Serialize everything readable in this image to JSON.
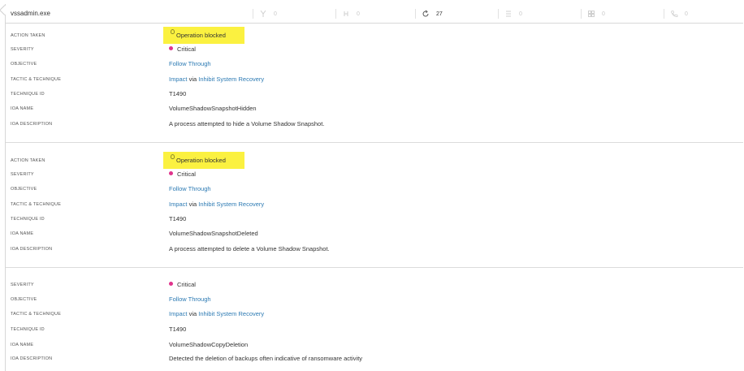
{
  "header": {
    "process_name": "vssadmin.exe",
    "stats": [
      {
        "icon": "branch-icon",
        "value": "0"
      },
      {
        "icon": "link-icon",
        "value": "0"
      },
      {
        "icon": "refresh-icon",
        "value": "27"
      },
      {
        "icon": "list-icon",
        "value": "0"
      },
      {
        "icon": "grid-icon",
        "value": "0"
      },
      {
        "icon": "phone-icon",
        "value": "0"
      }
    ]
  },
  "labels": {
    "action_taken": "ACTION TAKEN",
    "severity": "SEVERITY",
    "objective": "OBJECTIVE",
    "tactic_technique": "TACTIC & TECHNIQUE",
    "technique_id": "TECHNIQUE ID",
    "ioa_name": "IOA NAME",
    "ioa_description": "IOA DESCRIPTION",
    "via": "via"
  },
  "detections": [
    {
      "action": "Operation blocked",
      "severity": "Critical",
      "objective": "Follow Through",
      "tactic": "Impact",
      "technique": "Inhibit System Recovery",
      "technique_id": "T1490",
      "ioa_name": "VolumeShadowSnapshotHidden",
      "ioa_description": "A process attempted to hide a Volume Shadow Snapshot."
    },
    {
      "action": "Operation blocked",
      "severity": "Critical",
      "objective": "Follow Through",
      "tactic": "Impact",
      "technique": "Inhibit System Recovery",
      "technique_id": "T1490",
      "ioa_name": "VolumeShadowSnapshotDeleted",
      "ioa_description": "A process attempted to delete a Volume Shadow Snapshot."
    },
    {
      "severity": "Critical",
      "objective": "Follow Through",
      "tactic": "Impact",
      "technique": "Inhibit System Recovery",
      "technique_id": "T1490",
      "ioa_name": "VolumeShadowCopyDeletion",
      "ioa_description": "Detected the deletion of backups often indicative of ransomware activity"
    }
  ],
  "colors": {
    "highlight": "#fbf140",
    "severity_critical": "#e0338c",
    "link": "#2c7ab3"
  }
}
